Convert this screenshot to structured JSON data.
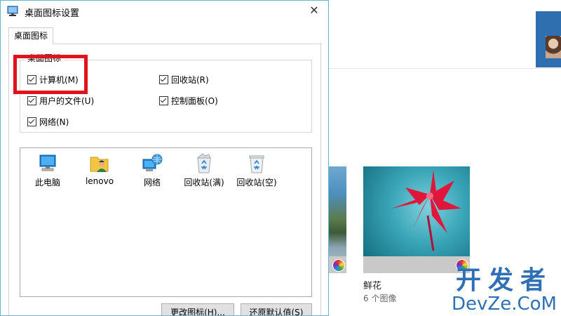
{
  "dialog": {
    "title": "桌面图标设置",
    "close_label": "✕",
    "tab_label": "桌面图标",
    "group_label": "桌面图标",
    "checkboxes": [
      {
        "label": "计算机(M)",
        "checked": true
      },
      {
        "label": "回收站(R)",
        "checked": true
      },
      {
        "label": "用户的文件(U)",
        "checked": true
      },
      {
        "label": "控制面板(O)",
        "checked": true
      },
      {
        "label": "网络(N)",
        "checked": true
      }
    ],
    "icons": [
      {
        "label": "此电脑",
        "icon": "computer-icon"
      },
      {
        "label": "lenovo",
        "icon": "user-folder-icon"
      },
      {
        "label": "网络",
        "icon": "network-icon"
      },
      {
        "label": "回收站(满)",
        "icon": "recycle-bin-full-icon"
      },
      {
        "label": "回收站(空)",
        "icon": "recycle-bin-empty-icon"
      }
    ],
    "buttons": {
      "change_icon": "更改图标(H)...",
      "restore_default": "还原默认值(S)"
    },
    "highlight_color": "#e0121d",
    "border_color": "#5fb9d6"
  },
  "background_app": {
    "album": {
      "name": "鲜花",
      "count": "6 个图像"
    }
  },
  "watermark": {
    "line1": "开发者",
    "line2": "DevZe.CoM"
  }
}
